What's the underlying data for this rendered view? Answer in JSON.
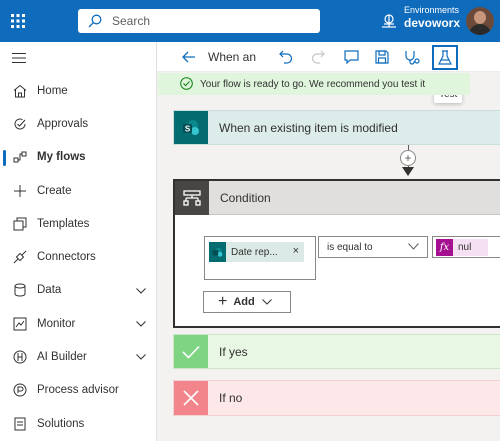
{
  "topbar": {
    "search_placeholder": "Search",
    "environment_label": "Environments",
    "environment_name": "devoworx"
  },
  "sidebar": {
    "items": [
      {
        "label": "Home",
        "icon": "home-icon"
      },
      {
        "label": "Approvals",
        "icon": "approvals-icon"
      },
      {
        "label": "My flows",
        "icon": "flow-icon",
        "active": true
      },
      {
        "label": "Create",
        "icon": "plus-icon"
      },
      {
        "label": "Templates",
        "icon": "templates-icon"
      },
      {
        "label": "Connectors",
        "icon": "connectors-icon"
      },
      {
        "label": "Data",
        "icon": "database-icon",
        "expandable": true
      },
      {
        "label": "Monitor",
        "icon": "monitor-icon",
        "expandable": true
      },
      {
        "label": "AI Builder",
        "icon": "ai-builder-icon",
        "expandable": true
      },
      {
        "label": "Process advisor",
        "icon": "process-advisor-icon"
      },
      {
        "label": "Solutions",
        "icon": "solutions-icon"
      }
    ]
  },
  "toolbar": {
    "flow_title": "When an",
    "test_tooltip": "Test"
  },
  "banner": {
    "message": "Your flow is ready to go. We recommend you test it"
  },
  "trigger": {
    "title": "When an existing item is modified"
  },
  "condition": {
    "title": "Condition",
    "left_token": "Date rep...",
    "token_remove": "×",
    "operator": "is equal to",
    "right_token": "nul",
    "fx_label": "fx",
    "add_label": "Add"
  },
  "branches": {
    "yes_label": "If yes",
    "no_label": "If no"
  },
  "colors": {
    "brand": "#0f6cbd",
    "sharepoint": "#036c70",
    "success_bg": "#dff6dd",
    "yes": "#7ed483",
    "no": "#f1858b",
    "expression": "#a4108f"
  }
}
